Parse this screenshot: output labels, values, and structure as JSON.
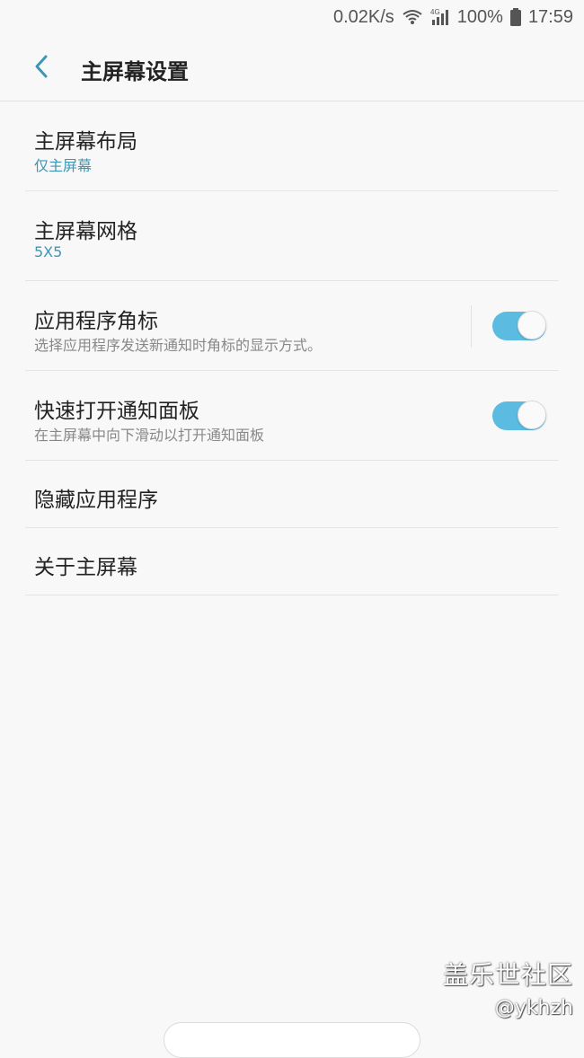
{
  "status_bar": {
    "net_speed": "0.02K/s",
    "network_type": "4G",
    "battery": "100%",
    "time": "17:59",
    "icons": [
      "wifi-icon",
      "cellular-signal-icon",
      "battery-icon"
    ]
  },
  "header": {
    "back_icon": "chevron-left-icon",
    "title": "主屏幕设置"
  },
  "settings": [
    {
      "title": "主屏幕布局",
      "subtitle": "仅主屏幕"
    },
    {
      "title": "主屏幕网格",
      "subtitle": "5X5"
    },
    {
      "title": "应用程序角标",
      "subtitle": "选择应用程序发送新通知时角标的显示方式。",
      "toggle": true
    },
    {
      "title": "快速打开通知面板",
      "subtitle": "在主屏幕中向下滑动以打开通知面板",
      "toggle": true
    },
    {
      "title": "隐藏应用程序"
    },
    {
      "title": "关于主屏幕"
    }
  ],
  "watermark": {
    "title": "盖乐世社区",
    "handle": "@ykhzh"
  },
  "colors": {
    "accent": "#3e96b5",
    "toggle_on": "#5bbbe1",
    "background": "#f8f8f8",
    "back_arrow": "#3e96b5"
  }
}
